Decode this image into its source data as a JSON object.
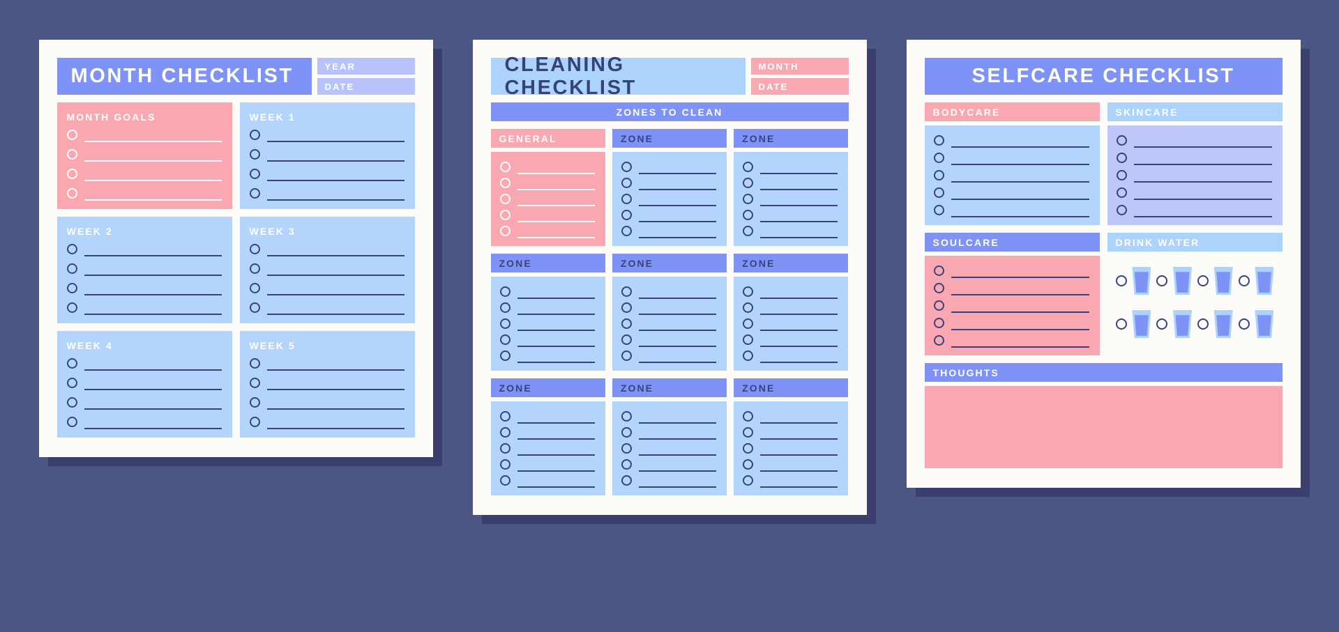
{
  "background_color": "#4c5684",
  "palette": {
    "periwinkle": "#7f92f5",
    "lavender": "#bfc6f9",
    "light_blue": "#abd3fb",
    "panel_blue": "#b3d5fb",
    "pink": "#f9a8b2",
    "navy": "#36437a",
    "paper": "#fdfcf8",
    "shadow": "#3a406b"
  },
  "cards": [
    {
      "id": "month-checklist",
      "title": "MONTH CHECKLIST",
      "meta": [
        {
          "label": "YEAR",
          "value": ""
        },
        {
          "label": "DATE",
          "value": ""
        }
      ],
      "sections": [
        {
          "id": "month-goals",
          "heading": "MONTH GOALS",
          "items": 4
        },
        {
          "id": "week-1",
          "heading": "WEEK 1",
          "items": 4
        },
        {
          "id": "week-2",
          "heading": "WEEK 2",
          "items": 4
        },
        {
          "id": "week-3",
          "heading": "WEEK 3",
          "items": 4
        },
        {
          "id": "week-4",
          "heading": "WEEK 4",
          "items": 4
        },
        {
          "id": "week-5",
          "heading": "WEEK 5",
          "items": 4
        }
      ]
    },
    {
      "id": "cleaning-checklist",
      "title": "CLEANING CHECKLIST",
      "meta": [
        {
          "label": "MONTH",
          "value": ""
        },
        {
          "label": "DATE",
          "value": ""
        }
      ],
      "strip": "ZONES TO CLEAN",
      "zones": [
        {
          "id": "general",
          "heading": "GENERAL",
          "items": 5,
          "style": "pink"
        },
        {
          "id": "zone-1",
          "heading": "ZONE",
          "items": 5,
          "style": "blue"
        },
        {
          "id": "zone-2",
          "heading": "ZONE",
          "items": 5,
          "style": "blue"
        },
        {
          "id": "zone-3",
          "heading": "ZONE",
          "items": 5,
          "style": "blue"
        },
        {
          "id": "zone-4",
          "heading": "ZONE",
          "items": 5,
          "style": "blue"
        },
        {
          "id": "zone-5",
          "heading": "ZONE",
          "items": 5,
          "style": "blue"
        },
        {
          "id": "zone-6",
          "heading": "ZONE",
          "items": 5,
          "style": "blue"
        },
        {
          "id": "zone-7",
          "heading": "ZONE",
          "items": 5,
          "style": "blue"
        },
        {
          "id": "zone-8",
          "heading": "ZONE",
          "items": 5,
          "style": "blue"
        }
      ]
    },
    {
      "id": "selfcare-checklist",
      "title": "SELFCARE CHECKLIST",
      "sections": [
        {
          "id": "bodycare",
          "heading": "BODYCARE",
          "items": 5
        },
        {
          "id": "skincare",
          "heading": "SKINCARE",
          "items": 5
        },
        {
          "id": "soulcare",
          "heading": "SOULCARE",
          "items": 5
        },
        {
          "id": "drink-water",
          "heading": "DRINK WATER",
          "rows": 2,
          "glasses_per_row": 4,
          "checks_per_row": 4
        },
        {
          "id": "thoughts",
          "heading": "THOUGHTS"
        }
      ]
    }
  ],
  "icons": {
    "checkbox": "circle-checkbox-icon",
    "write_line": "write-line-icon",
    "glass": "water-glass-icon"
  }
}
